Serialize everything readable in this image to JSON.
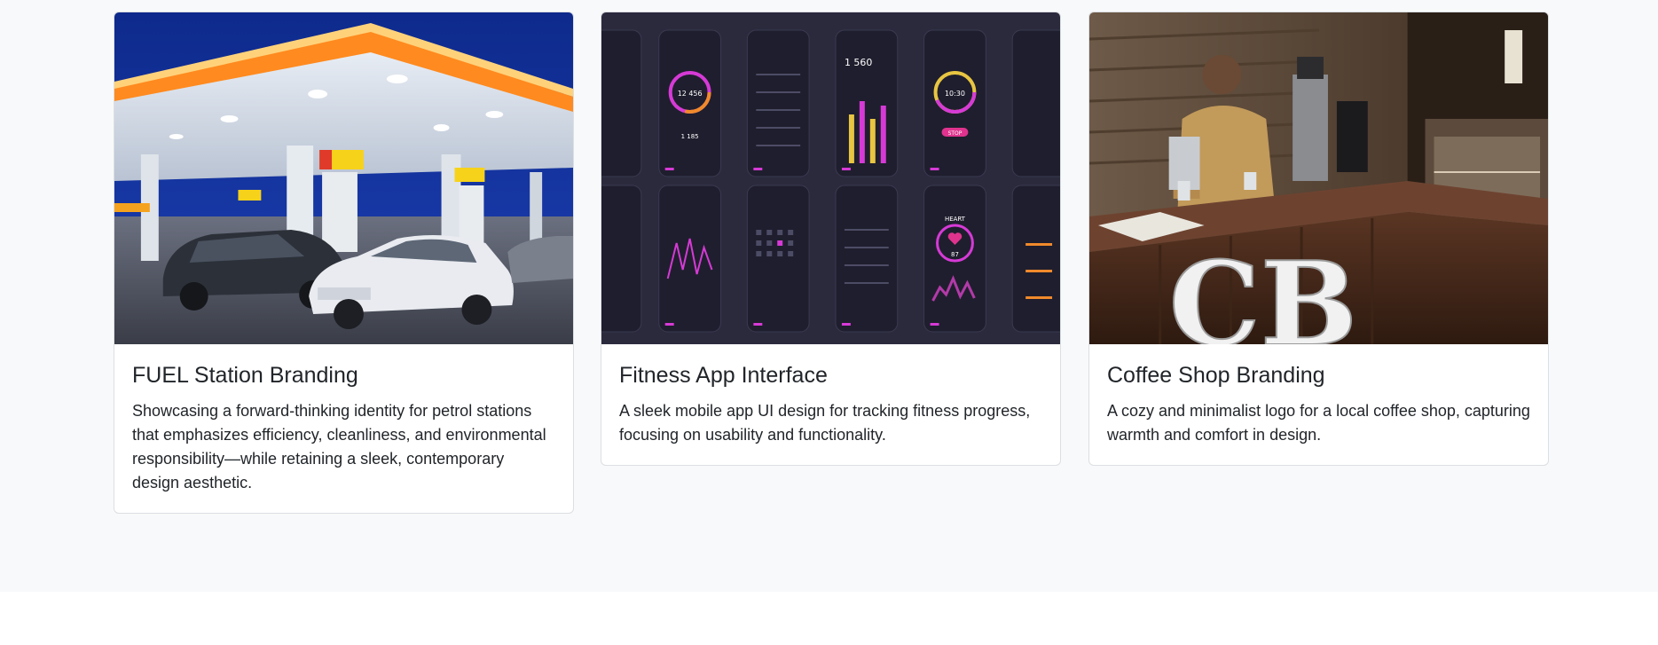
{
  "portfolio": {
    "cards": [
      {
        "image_alt": "Gas station at night",
        "title": "FUEL Station Branding",
        "description": "Showcasing a forward-thinking identity for petrol stations that emphasizes efficiency, cleanliness, and environmental responsibility—while retaining a sleek, contemporary design aesthetic."
      },
      {
        "image_alt": "Fitness app screens",
        "title": "Fitness App Interface",
        "description": "A sleek mobile app UI design for tracking fitness progress, focusing on usability and functionality."
      },
      {
        "image_alt": "Coffee shop interior",
        "title": "Coffee Shop Branding",
        "description": "A cozy and minimalist logo for a local coffee shop, capturing warmth and comfort in design."
      }
    ]
  },
  "fitness_screens": {
    "numbers": [
      "12 456",
      "1 185",
      "1 560",
      "10:30",
      "STOP",
      "HEART",
      "87"
    ]
  },
  "coffee_sign": "CB",
  "colors": {
    "page_bg": "#f8f9fa",
    "card_border": "#dcdfe3",
    "text": "#212529",
    "app_bg": "#2b2a3d",
    "app_accent": "#d63ad6",
    "canopy": "#ff8a1f",
    "fuel_yellow": "#f6d21a"
  }
}
